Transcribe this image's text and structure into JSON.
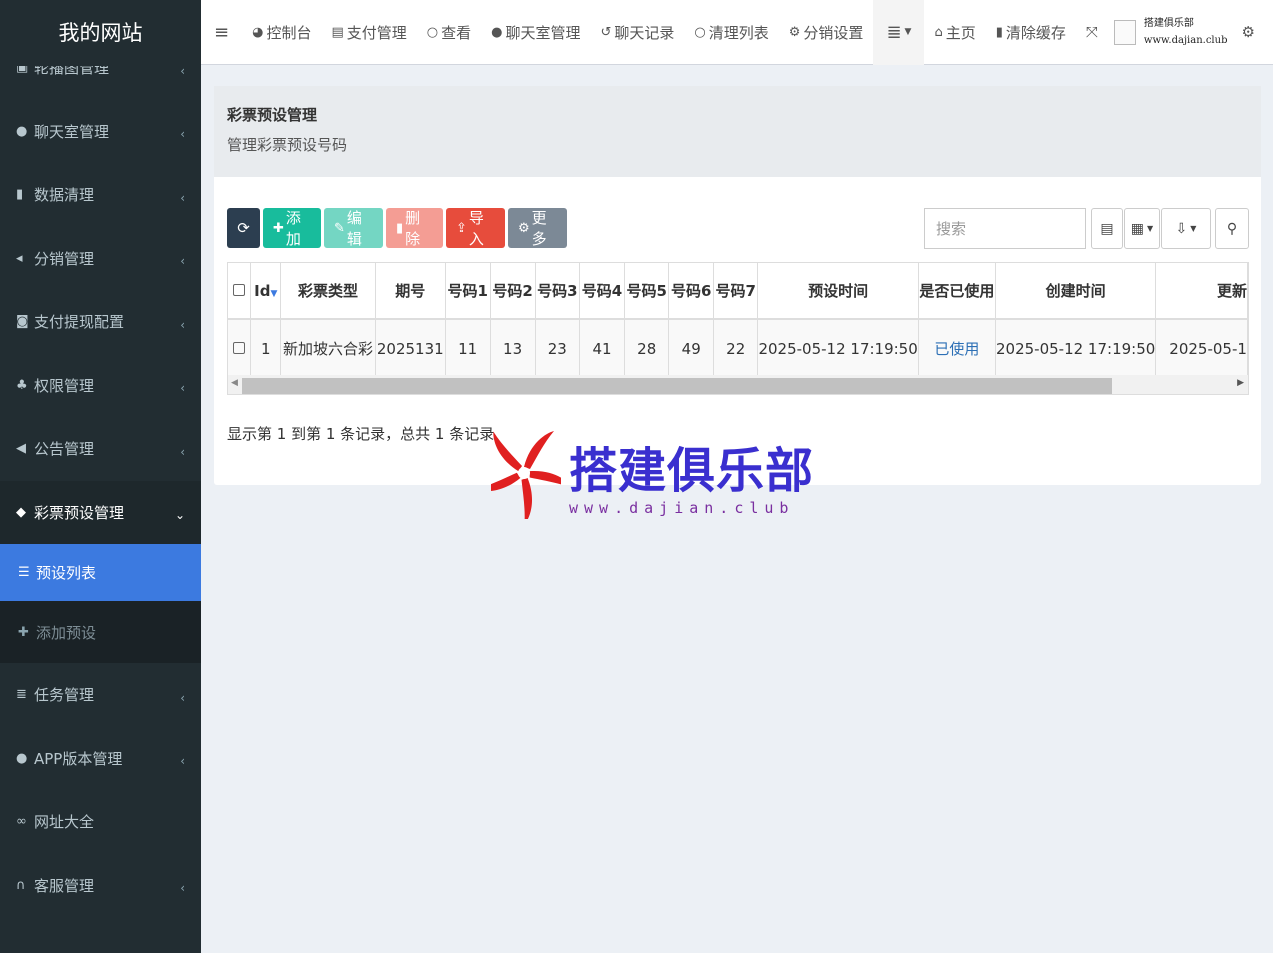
{
  "sidebar": {
    "logo": "我的网站",
    "items": [
      {
        "label": "轮播图管理",
        "icon": "image-icon"
      },
      {
        "label": "聊天室管理",
        "icon": "comment-icon"
      },
      {
        "label": "数据清理",
        "icon": "trash-icon"
      },
      {
        "label": "分销管理",
        "icon": "share-icon"
      },
      {
        "label": "支付提现配置",
        "icon": "money-icon"
      },
      {
        "label": "权限管理",
        "icon": "users-icon"
      },
      {
        "label": "公告管理",
        "icon": "bullhorn-icon"
      },
      {
        "label": "彩票预设管理",
        "icon": "tag-icon"
      }
    ],
    "sub_items": [
      {
        "label": "预设列表",
        "icon": "list-icon"
      },
      {
        "label": "添加预设",
        "icon": "plus-icon"
      }
    ],
    "items_after": [
      {
        "label": "任务管理",
        "icon": "server-icon"
      },
      {
        "label": "APP版本管理",
        "icon": "android-icon"
      },
      {
        "label": "网址大全",
        "icon": "link-icon"
      },
      {
        "label": "客服管理",
        "icon": "headset-icon"
      }
    ]
  },
  "topbar": {
    "items": [
      {
        "label": "控制台",
        "icon": "dashboard-icon"
      },
      {
        "label": "支付管理",
        "icon": "card-icon"
      },
      {
        "label": "查看",
        "icon": "circle-icon"
      },
      {
        "label": "聊天室管理",
        "icon": "comment-icon"
      },
      {
        "label": "聊天记录",
        "icon": "history-icon"
      },
      {
        "label": "清理列表",
        "icon": "circle-icon"
      },
      {
        "label": "分销设置",
        "icon": "cogs-icon"
      }
    ],
    "home": "主页",
    "clear_cache": "清除缓存",
    "user_line1": "搭建俱乐部",
    "user_line2": "www.dajian.club"
  },
  "header": {
    "title": "彩票预设管理",
    "subtitle": "管理彩票预设号码"
  },
  "toolbar": {
    "add": "添加",
    "edit": "编辑",
    "delete": "删除",
    "import": "导入",
    "more": "更多",
    "search_placeholder": "搜索"
  },
  "table": {
    "columns": [
      "Id",
      "彩票类型",
      "期号",
      "号码1",
      "号码2",
      "号码3",
      "号码4",
      "号码5",
      "号码6",
      "号码7",
      "预设时间",
      "是否已使用",
      "创建时间",
      "更新"
    ],
    "rows": [
      [
        "1",
        "新加坡六合彩",
        "2025131",
        "11",
        "13",
        "23",
        "41",
        "28",
        "49",
        "22",
        "2025-05-12 17:19:50",
        "已使用",
        "2025-05-12 17:19:50",
        "2025-05-1"
      ]
    ]
  },
  "summary": "显示第 1 到第 1 条记录，总共 1 条记录",
  "watermark": {
    "title": "搭建俱乐部",
    "url": "www.dajian.club"
  },
  "colors": {
    "sidebar_bg": "#222d32",
    "active_blue": "#3c7ae0",
    "btn_add": "#18bc9c",
    "btn_import": "#e74c3c"
  }
}
